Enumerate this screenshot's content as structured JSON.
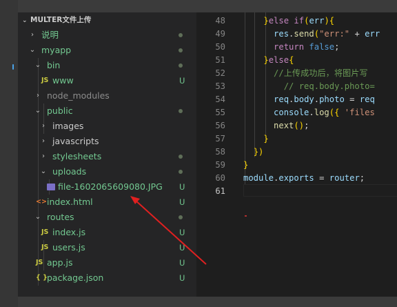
{
  "explorer": {
    "section_title": "MULTER文件上传",
    "items": [
      {
        "label": "说明",
        "type": "folder",
        "expanded": false,
        "depth": 0,
        "status": "dot",
        "color": "#73c991"
      },
      {
        "label": "myapp",
        "type": "folder",
        "expanded": true,
        "depth": 0,
        "status": "dot",
        "color": "#73c991"
      },
      {
        "label": "bin",
        "type": "folder",
        "expanded": true,
        "depth": 1,
        "status": "dot",
        "color": "#73c991"
      },
      {
        "label": "www",
        "type": "js",
        "icon_text": "JS",
        "depth": 2,
        "status": "U",
        "color": "#73c991"
      },
      {
        "label": "node_modules",
        "type": "folder",
        "expanded": false,
        "depth": 1,
        "status": "",
        "color": "#8c8c8c"
      },
      {
        "label": "public",
        "type": "folder",
        "expanded": true,
        "depth": 1,
        "status": "dot",
        "color": "#73c991"
      },
      {
        "label": "images",
        "type": "folder",
        "expanded": false,
        "depth": 2,
        "status": "",
        "color": "#cccccc"
      },
      {
        "label": "javascripts",
        "type": "folder",
        "expanded": false,
        "depth": 2,
        "status": "",
        "color": "#cccccc"
      },
      {
        "label": "stylesheets",
        "type": "folder",
        "expanded": false,
        "depth": 2,
        "status": "dot",
        "color": "#73c991"
      },
      {
        "label": "uploads",
        "type": "folder",
        "expanded": true,
        "depth": 2,
        "status": "dot",
        "color": "#73c991"
      },
      {
        "label": "file-1602065609080.JPG",
        "type": "image",
        "depth": 3,
        "status": "U",
        "color": "#73c991"
      },
      {
        "label": "index.html",
        "type": "html",
        "icon_text": "<>",
        "depth": 1,
        "status": "U",
        "color": "#73c991"
      },
      {
        "label": "routes",
        "type": "folder",
        "expanded": true,
        "depth": 1,
        "status": "dot",
        "color": "#73c991"
      },
      {
        "label": "index.js",
        "type": "js",
        "icon_text": "JS",
        "depth": 2,
        "status": "U",
        "color": "#73c991"
      },
      {
        "label": "users.js",
        "type": "js",
        "icon_text": "JS",
        "depth": 2,
        "status": "U",
        "color": "#73c991"
      },
      {
        "label": "app.js",
        "type": "js",
        "icon_text": "JS",
        "depth": 1,
        "status": "U",
        "color": "#73c991"
      },
      {
        "label": "package.json",
        "type": "json",
        "icon_text": "{ }",
        "depth": 1,
        "status": "U",
        "color": "#73c991"
      }
    ],
    "chevron_expanded": "⌄",
    "chevron_collapsed": "›"
  },
  "editor": {
    "active_line": "61",
    "lines": [
      {
        "n": "48",
        "code": "    }else if(err){"
      },
      {
        "n": "49",
        "code": "      res.send(\"err:\" + err"
      },
      {
        "n": "50",
        "code": "      return false;"
      },
      {
        "n": "51",
        "code": "    }else{"
      },
      {
        "n": "52",
        "code": "      //上传成功后，将图片写"
      },
      {
        "n": "53",
        "code": "        // req.body.photo="
      },
      {
        "n": "54",
        "code": "      req.body.photo = req"
      },
      {
        "n": "55",
        "code": "      console.log({ 'files"
      },
      {
        "n": "56",
        "code": "      next();"
      },
      {
        "n": "57",
        "code": "    }"
      },
      {
        "n": "58",
        "code": "  })"
      },
      {
        "n": "59",
        "code": "}"
      },
      {
        "n": "60",
        "code": "module.exports = router;"
      },
      {
        "n": "61",
        "code": ""
      }
    ]
  },
  "colors": {
    "accent_green": "#73c991",
    "arrow_red": "#e02020",
    "sidebar_bg": "#252526",
    "editor_bg": "#1e1e1e"
  }
}
